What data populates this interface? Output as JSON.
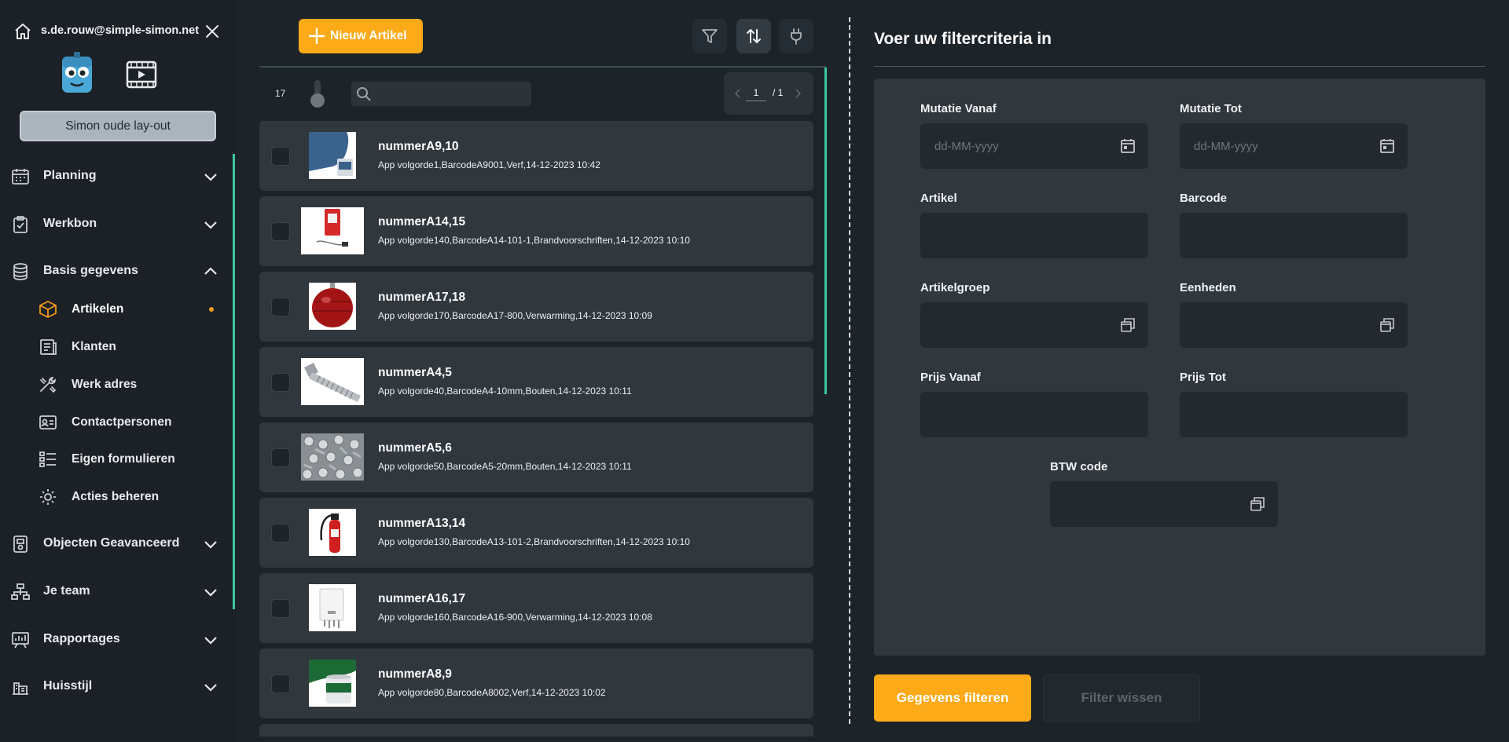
{
  "user": {
    "email": "s.de.rouw@simple-simon.net"
  },
  "sidebar": {
    "old_layout_label": "Simon oude lay-out",
    "items": [
      {
        "label": "Planning",
        "icon": "calendar-icon"
      },
      {
        "label": "Werkbon",
        "icon": "clipboard-icon"
      },
      {
        "label": "Basis gegevens",
        "icon": "database-icon"
      },
      {
        "label": "Objecten Geavanceerd",
        "icon": "objects-icon"
      },
      {
        "label": "Je team",
        "icon": "team-icon"
      },
      {
        "label": "Rapportages",
        "icon": "report-icon"
      },
      {
        "label": "Huisstijl",
        "icon": "brand-icon"
      }
    ],
    "subitems": [
      {
        "label": "Artikelen",
        "icon": "box-icon",
        "active": true
      },
      {
        "label": "Klanten",
        "icon": "customers-icon"
      },
      {
        "label": "Werk adres",
        "icon": "tools-icon"
      },
      {
        "label": "Contactpersonen",
        "icon": "contact-card-icon"
      },
      {
        "label": "Eigen formulieren",
        "icon": "form-list-icon"
      },
      {
        "label": "Acties beheren",
        "icon": "gear-icon"
      }
    ]
  },
  "list": {
    "new_button_label": "Nieuw Artikel",
    "count": "17",
    "search_value": "",
    "page": "1",
    "total_pages": "/ 1",
    "rows": [
      {
        "title": "nummerA9,10",
        "sub": "App volgorde1,BarcodeA9001,Verf,14-12-2023 10:42",
        "thumb": "blue-paint"
      },
      {
        "title": "nummerA14,15",
        "sub": "App volgorde140,BarcodeA14-101-1,Brandvoorschriften,14-12-2023 10:10",
        "thumb": "fire-box"
      },
      {
        "title": "nummerA17,18",
        "sub": "App volgorde170,BarcodeA17-800,Verwarming,14-12-2023 10:09",
        "thumb": "expansion-vessel"
      },
      {
        "title": "nummerA4,5",
        "sub": "App volgorde40,BarcodeA4-10mm,Bouten,14-12-2023 10:11",
        "thumb": "bolt"
      },
      {
        "title": "nummerA5,6",
        "sub": "App volgorde50,BarcodeA5-20mm,Bouten,14-12-2023 10:11",
        "thumb": "bolts-pile"
      },
      {
        "title": "nummerA13,14",
        "sub": "App volgorde130,BarcodeA13-101-2,Brandvoorschriften,14-12-2023 10:10",
        "thumb": "extinguisher"
      },
      {
        "title": "nummerA16,17",
        "sub": "App volgorde160,BarcodeA16-900,Verwarming,14-12-2023 10:08",
        "thumb": "boiler"
      },
      {
        "title": "nummerA8,9",
        "sub": "App volgorde80,BarcodeA8002,Verf,14-12-2023 10:02",
        "thumb": "green-paint"
      }
    ]
  },
  "filter": {
    "title": "Voer uw filtercriteria in",
    "fields": {
      "mutatie_vanaf": {
        "label": "Mutatie Vanaf",
        "placeholder": "dd-MM-yyyy"
      },
      "mutatie_tot": {
        "label": "Mutatie Tot",
        "placeholder": "dd-MM-yyyy"
      },
      "artikel": {
        "label": "Artikel",
        "placeholder": ""
      },
      "barcode": {
        "label": "Barcode",
        "placeholder": ""
      },
      "artikelgroep": {
        "label": "Artikelgroep",
        "placeholder": ""
      },
      "eenheden": {
        "label": "Eenheden",
        "placeholder": ""
      },
      "prijs_vanaf": {
        "label": "Prijs Vanaf",
        "placeholder": ""
      },
      "prijs_tot": {
        "label": "Prijs Tot",
        "placeholder": ""
      },
      "btw_code": {
        "label": "BTW code",
        "placeholder": ""
      }
    },
    "apply_label": "Gegevens filteren",
    "clear_label": "Filter wissen"
  },
  "colors": {
    "accent": "#fcaa18",
    "teal": "#3cc7a4",
    "bg": "#1c2329",
    "card": "#30373d"
  }
}
